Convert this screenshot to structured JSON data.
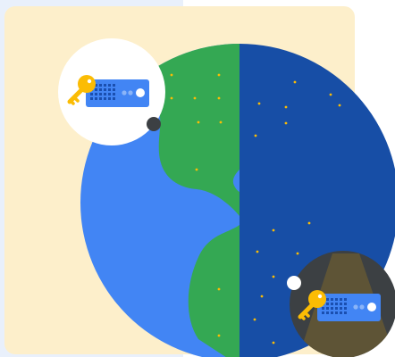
{
  "illustration": {
    "subject": "day-night-globe-with-hardware-security-keys",
    "icons": [
      "key-icon",
      "server-icon",
      "globe-icon"
    ],
    "colors": {
      "panel_back": "#E9F0FB",
      "panel_front": "#FDEFCB",
      "globe_ocean": "#4285F4",
      "globe_land": "#34A853",
      "night_side": "#174EA6",
      "star": "#FBBC04",
      "key": "#FBBC04",
      "server": "#4285F4",
      "badge_day": "#FFFFFF",
      "badge_night": "#3C4043",
      "light_beam": "#5E5436"
    }
  }
}
